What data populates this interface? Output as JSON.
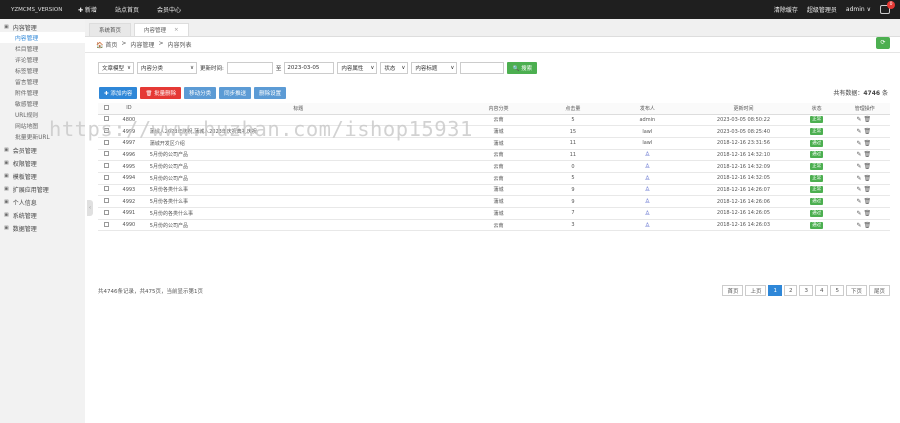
{
  "topbar": {
    "brand": "YZMCMS_VERSION",
    "nav": [
      "✚ 新增",
      "站点首页",
      "会员中心"
    ],
    "right": [
      "清除缓存",
      "超级管理员",
      "admin ∨"
    ],
    "badge": "0"
  },
  "sidebar": {
    "groups": [
      {
        "label": "内容管理",
        "items": [
          "内容管理",
          "栏目管理",
          "评论管理",
          "标签管理",
          "留言管理",
          "附件管理",
          "敏感管理",
          "URL规则",
          "网站地图",
          "批量更新URL"
        ]
      },
      {
        "label": "会员管理"
      },
      {
        "label": "权限管理"
      },
      {
        "label": "模板管理"
      },
      {
        "label": "扩展应用管理"
      },
      {
        "label": "个人信息"
      },
      {
        "label": "系统管理"
      },
      {
        "label": "数据管理"
      }
    ]
  },
  "tabs": [
    {
      "label": "系统首页"
    },
    {
      "label": "内容管理",
      "close": "×"
    }
  ],
  "breadcrumb": [
    "🏠 首页",
    ">",
    "内容管理",
    ">",
    "内容列表"
  ],
  "filters": {
    "model": "文章模型",
    "cat": "内容分类",
    "time_label": "更新时间:",
    "start": "",
    "sep": "至",
    "end": "2023-03-05",
    "attr": "内容属性",
    "status": "状态",
    "title": "内容标题",
    "keyword": "",
    "search": "🔍 搜索"
  },
  "actions": [
    "✚ 添加内容",
    "🗑 批量删除",
    "移动分类",
    "同步推送",
    "删除设置"
  ],
  "total_label": "共有数据：",
  "total": "4746",
  "total_unit": "条",
  "table": {
    "headers": [
      "",
      "ID",
      "标题",
      "内容分类",
      "点击量",
      "发布人",
      "更新时间",
      "状态",
      "管理操作"
    ],
    "rows": [
      [
        "4800",
        "",
        "云南",
        "5",
        "admin",
        "2023-03-05 08:50:22",
        "正常"
      ],
      [
        "4999",
        "蒲城人2023年庆祝,蒲城人2023年庆祝典礼庆祝",
        "蒲城",
        "15",
        "lawl",
        "2023-03-05 08:25:40",
        "正常"
      ],
      [
        "4997",
        "蒲城开发区介绍",
        "蒲城",
        "11",
        "lawl",
        "2018-12-16 23:31:56",
        "通过"
      ],
      [
        "4996",
        "5月份的公司产品",
        "云南",
        "11",
        "人",
        "2018-12-16 14:32:10",
        "通过"
      ],
      [
        "4995",
        "5月份的公司产品",
        "云南",
        "0",
        "人",
        "2018-12-16 14:32:09",
        "正常"
      ],
      [
        "4994",
        "5月份的公司产品",
        "云南",
        "5",
        "人",
        "2018-12-16 14:32:05",
        "正常"
      ],
      [
        "4993",
        "5月份各类什么事",
        "蒲城",
        "9",
        "人",
        "2018-12-16 14:26:07",
        "正常"
      ],
      [
        "4992",
        "5月份各类什么事",
        "蒲城",
        "9",
        "人",
        "2018-12-16 14:26:06",
        "通过"
      ],
      [
        "4991",
        "5月份的各类什么事",
        "蒲城",
        "7",
        "人",
        "2018-12-16 14:26:05",
        "通过"
      ],
      [
        "4990",
        "5月份的公司产品",
        "云南",
        "3",
        "人",
        "2018-12-16 14:26:03",
        "通过"
      ]
    ]
  },
  "footer": "共4746条记录，共475页，当前显示第1页",
  "pager": [
    "首页",
    "上页",
    "1",
    "2",
    "3",
    "4",
    "5",
    "下页",
    "尾页"
  ],
  "watermark": "https://www.huzhan.com/ishop15931"
}
